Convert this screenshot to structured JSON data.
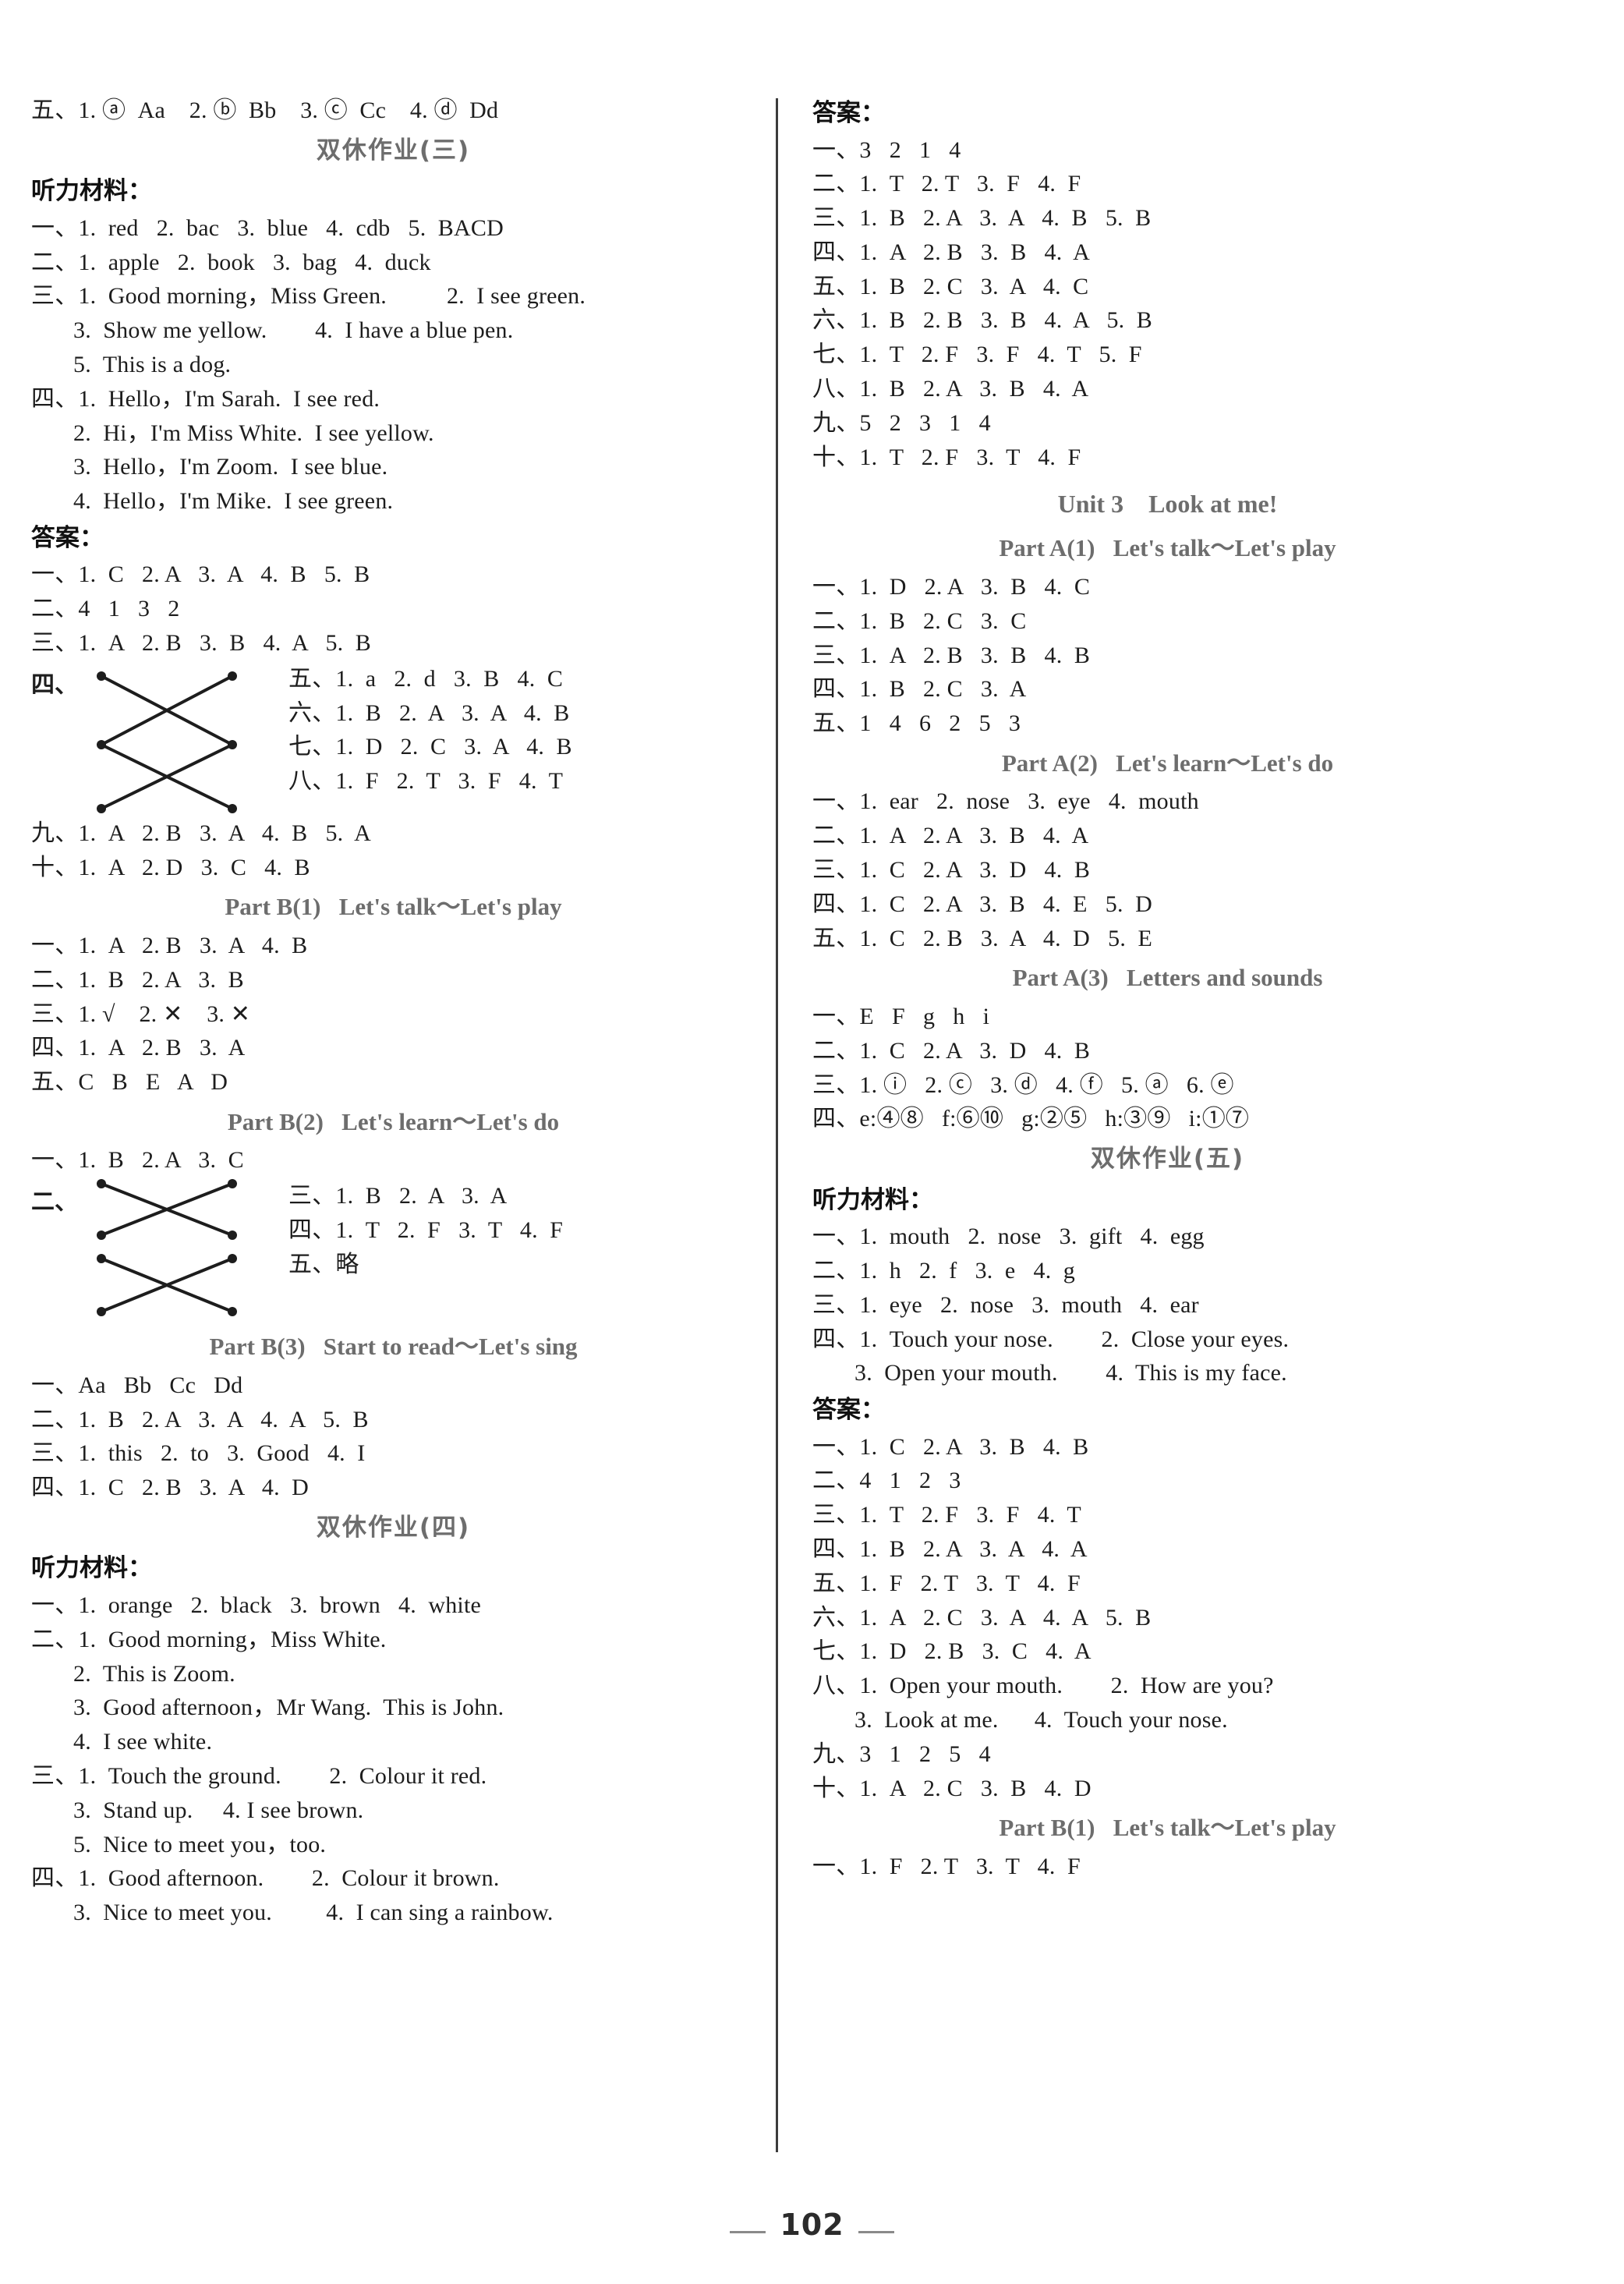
{
  "page": {
    "number": "102",
    "theme_color": "#1d1d1d",
    "heading_color": "#6d6d6d"
  },
  "left_column": {
    "top_answer_line": "五、1. ⓐ  Aa    2. ⓑ  Bb    3. ⓒ  Cc    4. ⓓ  Dd",
    "section_weekend3_title": "双休作业(三)",
    "listening_label": "听力材料：",
    "listening_lines": [
      "一、1.  red   2.  bac   3.  blue   4.  cdb   5.  BACD",
      "二、1.  apple   2.  book   3.  bag   4.  duck",
      "三、1.  Good morning，Miss Green.          2.  I see green.",
      "3.  Show me yellow.        4.  I have a blue pen.",
      "5.  This is a dog.",
      "四、1.  Hello，I'm Sarah.  I see red.",
      "2.  Hi，I'm Miss White.  I see yellow.",
      "3.  Hello，I'm Zoom.  I see blue.",
      "4.  Hello，I'm Mike.  I see green."
    ],
    "answers_label": "答案：",
    "answer_lines_a": [
      "一、1.  C   2. A   3.  A   4.  B   5.  B",
      "二、4   1   3   2",
      "三、1.  A   2. B   3.  B   4.  A   5.  B"
    ],
    "x_block_1": {
      "label": "四、",
      "right_lines": [
        "五、1.  a   2.  d   3.  B   4.  C",
        "六、1.  B   2.  A   3.  A   4.  B",
        "七、1.  D   2.  C   3.  A   4.  B",
        "八、1.  F   2.  T   3.  F   4.  T"
      ]
    },
    "answer_lines_b": [
      "九、1.  A   2. B   3.  A   4.  B   5.  A",
      "十、1.  A   2. D   3.  C   4.  B"
    ],
    "partB1_title": "Part B(1)   Let's talk～Let's play",
    "partB1_lines": [
      "一、1.  A   2. B   3.  A   4.  B",
      "二、1.  B   2. A   3.  B",
      "三、1. √    2. ✕    3. ✕",
      "四、1.  A   2. B   3.  A",
      "五、C   B   E   A   D"
    ],
    "partB2_title": "Part B(2)   Let's learn～Let's do",
    "partB2_first": "一、1.  B   2. A   3.  C",
    "x_block_2": {
      "label": "二、",
      "right_lines": [
        "三、1.  B   2.  A   3.  A",
        "四、1.  T   2.  F   3.  T   4.  F",
        "五、略"
      ]
    },
    "partB3_title": "Part B(3)   Start to read～Let's sing",
    "partB3_lines": [
      "一、Aa   Bb   Cc   Dd",
      "二、1.  B   2. A   3.  A   4.  A   5.  B",
      "三、1.  this   2.  to   3.  Good   4.  I",
      "四、1.  C   2. B   3.  A   4.  D"
    ],
    "section_weekend4_title": "双休作业(四)",
    "listening_label_2": "听力材料：",
    "listening_lines_2": [
      "一、1.  orange   2.  black   3.  brown   4.  white",
      "二、1.  Good morning，Miss White.",
      "2.  This is Zoom.",
      "3.  Good afternoon，Mr Wang.  This is John.",
      "4.  I see white.",
      "三、1.  Touch the ground.        2.  Colour it red.",
      "3.  Stand up.     4. I see brown.",
      "5.  Nice to meet you，too.",
      "四、1.  Good afternoon.        2.  Colour it brown.",
      "3.  Nice to meet you.         4.  I can sing a rainbow."
    ]
  },
  "right_column": {
    "answers_label": "答案：",
    "answer_lines_top": [
      "一、3   2   1   4",
      "二、1.  T   2. T   3.  F   4.  F",
      "三、1.  B   2. A   3.  A   4.  B   5.  B",
      "四、1.  A   2. B   3.  B   4.  A",
      "五、1.  B   2. C   3.  A   4.  C",
      "六、1.  B   2. B   3.  B   4.  A   5.  B",
      "七、1.  T   2. F   3.  F   4.  T   5.  F",
      "八、1.  B   2. A   3.  B   4.  A",
      "九、5   2   3   1   4",
      "十、1.  T   2. F   3.  T   4.  F"
    ],
    "unit3_title": "Unit 3    Look at me!",
    "partA1_title": "Part A(1)   Let's talk～Let's play",
    "partA1_lines": [
      "一、1.  D   2. A   3.  B   4.  C",
      "二、1.  B   2. C   3.  C",
      "三、1.  A   2. B   3.  B   4.  B",
      "四、1.  B   2. C   3.  A",
      "五、1   4   6   2   5   3"
    ],
    "partA2_title": "Part A(2)   Let's learn～Let's do",
    "partA2_lines": [
      "一、1.  ear   2.  nose   3.  eye   4.  mouth",
      "二、1.  A   2. A   3.  B   4.  A",
      "三、1.  C   2. A   3.  D   4.  B",
      "四、1.  C   2. A   3.  B   4.  E   5.  D",
      "五、1.  C   2. B   3.  A   4.  D   5.  E"
    ],
    "partA3_title": "Part A(3)   Letters and sounds",
    "partA3_lines": [
      "一、E   F   g   h   i",
      "二、1.  C   2. A   3.  D   4.  B",
      "三、1. ⓘ   2. ⓒ   3. ⓓ   4. ⓕ   5. ⓐ   6. ⓔ",
      "四、e:④⑧   f:⑥⑩   g:②⑤   h:③⑨   i:①⑦"
    ],
    "section_weekend5_title": "双休作业(五)",
    "listening_label": "听力材料：",
    "listening_lines": [
      "一、1.  mouth   2.  nose   3.  gift   4.  egg",
      "二、1.  h   2.  f   3.  e   4.  g",
      "三、1.  eye   2.  nose   3.  mouth   4.  ear",
      "四、1.  Touch your nose.        2.  Close your eyes.",
      "3.  Open your mouth.        4.  This is my face."
    ],
    "answers_label_2": "答案：",
    "answer_lines_bottom": [
      "一、1.  C   2. A   3.  B   4.  B",
      "二、4   1   2   3",
      "三、1.  T   2. F   3.  F   4.  T",
      "四、1.  B   2. A   3.  A   4.  A",
      "五、1.  F   2. T   3.  T   4.  F",
      "六、1.  A   2. C   3.  A   4.  A   5.  B",
      "七、1.  D   2. B   3.  C   4.  A",
      "八、1.  Open your mouth.        2.  How are you?",
      "3.  Look at me.      4.  Touch your nose.",
      "九、3   1   2   5   4",
      "十、1.  A   2. C   3.  B   4.  D"
    ],
    "partB1_title": "Part B(1)   Let's talk～Let's play",
    "partB1_first": "一、1.  F   2. T   3.  T   4.  F"
  }
}
